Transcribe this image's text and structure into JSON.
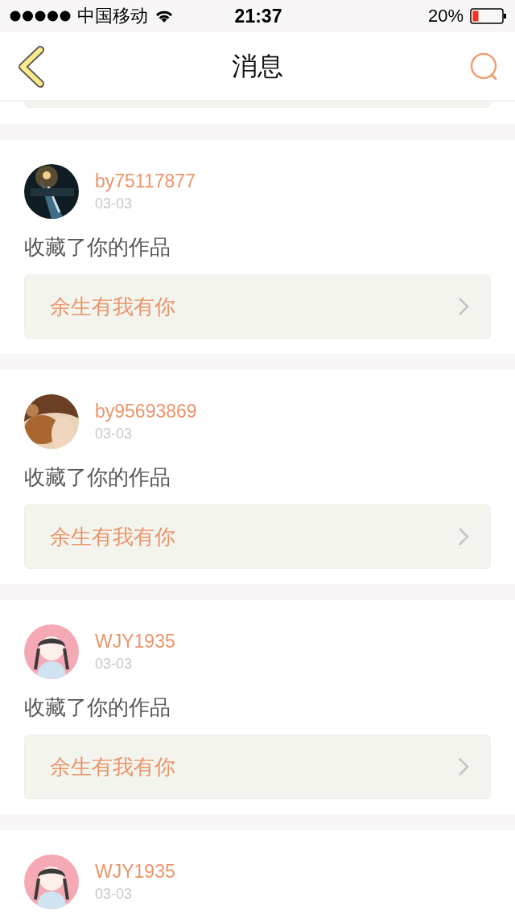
{
  "status_bar": {
    "carrier": "中国移动",
    "time": "21:37",
    "battery": "20%"
  },
  "header": {
    "title": "消息"
  },
  "messages": [
    {
      "user": "by75117877",
      "date": "03-03",
      "action": "收藏了你的作品",
      "work": "余生有我有你"
    },
    {
      "user": "by95693869",
      "date": "03-03",
      "action": "收藏了你的作品",
      "work": "余生有我有你"
    },
    {
      "user": "WJY1935",
      "date": "03-03",
      "action": "收藏了你的作品",
      "work": "余生有我有你"
    },
    {
      "user": "WJY1935",
      "date": "03-03"
    }
  ]
}
